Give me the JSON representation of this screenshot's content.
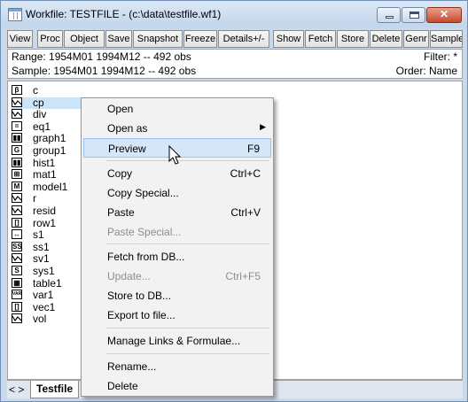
{
  "window": {
    "title": "Workfile: TESTFILE - (c:\\data\\testfile.wf1)",
    "buttons": {
      "minimize": "minimize-icon",
      "maximize": "maximize-icon",
      "close": "close-icon",
      "close_glyph": "✕"
    }
  },
  "toolbar": {
    "buttons": [
      "View",
      "Proc",
      "Object",
      "Save",
      "Snapshot",
      "Freeze",
      "Details+/-",
      "Show",
      "Fetch",
      "Store",
      "Delete",
      "Genr",
      "Sample"
    ]
  },
  "info": {
    "range_line": "Range:  1954M01 1994M12  --  492 obs",
    "sample_line": "Sample: 1954M01 1994M12  --  492 obs",
    "filter": "Filter: *",
    "order": "Order: Name"
  },
  "objects": [
    {
      "name": "c",
      "icon": "coef-icon",
      "glyph": "β"
    },
    {
      "name": "cp",
      "icon": "series-icon",
      "glyph": "",
      "selected": true
    },
    {
      "name": "div",
      "icon": "series-icon",
      "glyph": ""
    },
    {
      "name": "eq1",
      "icon": "equation-icon",
      "glyph": "="
    },
    {
      "name": "graph1",
      "icon": "graph-icon",
      "glyph": "▮▮"
    },
    {
      "name": "group1",
      "icon": "group-icon",
      "glyph": "G"
    },
    {
      "name": "hist1",
      "icon": "graph-icon",
      "glyph": "▮▮"
    },
    {
      "name": "mat1",
      "icon": "matrix-icon",
      "glyph": "⊞"
    },
    {
      "name": "model1",
      "icon": "model-icon",
      "glyph": "M"
    },
    {
      "name": "r",
      "icon": "series-icon",
      "glyph": ""
    },
    {
      "name": "resid",
      "icon": "series-icon",
      "glyph": ""
    },
    {
      "name": "row1",
      "icon": "rowvector-icon",
      "glyph": "[]"
    },
    {
      "name": "s1",
      "icon": "scalar-icon",
      "glyph": "↔"
    },
    {
      "name": "ss1",
      "icon": "sspace-icon",
      "glyph": "SS"
    },
    {
      "name": "sv1",
      "icon": "series-icon",
      "glyph": ""
    },
    {
      "name": "sys1",
      "icon": "system-icon",
      "glyph": "S"
    },
    {
      "name": "table1",
      "icon": "table-icon",
      "glyph": "▦"
    },
    {
      "name": "var1",
      "icon": "var-icon",
      "glyph": "VAR"
    },
    {
      "name": "vec1",
      "icon": "vector-icon",
      "glyph": "[]"
    },
    {
      "name": "vol",
      "icon": "series-icon",
      "glyph": ""
    }
  ],
  "tabs": {
    "nav": "< >",
    "active": "Testfile"
  },
  "context_menu": {
    "items": [
      {
        "label": "Open",
        "shortcut": "",
        "disabled": false
      },
      {
        "label": "Open as",
        "shortcut": "",
        "submenu": true,
        "disabled": false
      },
      {
        "label": "Preview",
        "shortcut": "F9",
        "highlighted": true,
        "disabled": false
      },
      {
        "label": "Copy",
        "shortcut": "Ctrl+C",
        "disabled": false
      },
      {
        "label": "Copy Special...",
        "shortcut": "",
        "disabled": false
      },
      {
        "label": "Paste",
        "shortcut": "Ctrl+V",
        "disabled": false
      },
      {
        "label": "Paste Special...",
        "shortcut": "",
        "disabled": true
      },
      {
        "label": "Fetch from DB...",
        "shortcut": "",
        "disabled": false
      },
      {
        "label": "Update...",
        "shortcut": "Ctrl+F5",
        "disabled": true
      },
      {
        "label": "Store to DB...",
        "shortcut": "",
        "disabled": false
      },
      {
        "label": "Export to file...",
        "shortcut": "",
        "disabled": false
      },
      {
        "label": "Manage Links & Formulae...",
        "shortcut": "",
        "disabled": false
      },
      {
        "label": "Rename...",
        "shortcut": "",
        "disabled": false
      },
      {
        "label": "Delete",
        "shortcut": "",
        "disabled": false
      }
    ],
    "submenu_arrow": "▶"
  },
  "colors": {
    "selection": "#cce4f7",
    "menu_highlight": "#d5e6f8",
    "chrome": "#c9d9ec"
  }
}
